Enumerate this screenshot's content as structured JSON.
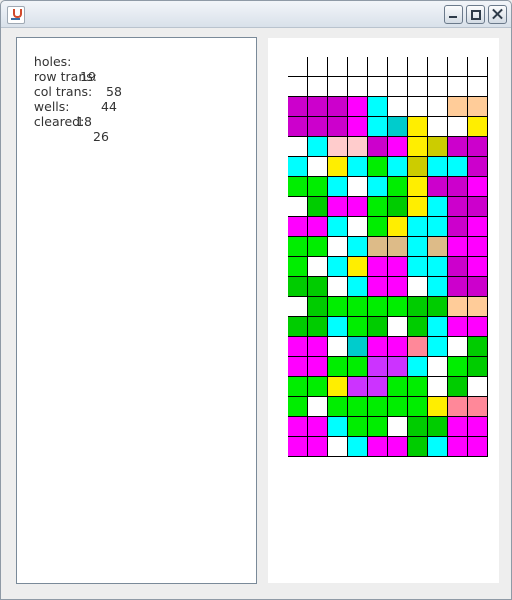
{
  "window": {
    "title": "",
    "controls": [
      "minimize-icon",
      "maximize-icon",
      "close-icon"
    ]
  },
  "stats": [
    {
      "label": "holes:",
      "value": "19"
    },
    {
      "label": "row trans:",
      "value": "58"
    },
    {
      "label": "col trans:",
      "value": "44"
    },
    {
      "label": "wells:",
      "value": "18"
    },
    {
      "label": "cleared:",
      "value": "26"
    }
  ],
  "colors": {
    "w": "#ffffff",
    "m": "#ff00ff",
    "p": "#cc00cc",
    "c": "#00ffff",
    "t": "#00cccc",
    "g": "#00ee00",
    "d": "#00cc00",
    "y": "#ffee00",
    "o": "#cccc00",
    "n": "#ffcccc",
    "s": "#ffcc99",
    "b": "#ddbb88",
    "r": "#ff8899",
    "v": "#cc33ff",
    "k": "#44dddd"
  },
  "board": {
    "columns": 10,
    "rows": [
      "wwwwwwwwww",
      "wwwwwwwwww",
      "pppmcwwwss",
      "pppmctywwy",
      "wcnnpmyoppp",
      "cwycgcoccpm",
      "ggcwcgyppm",
      "wdmmgdycpp",
      "mmcwgyccpm",
      "ggwcbbcbmm",
      "gwcymmccpm",
      "ddwcmmwcpp",
      "wdggggddss",
      "ddcgdwdcmm",
      "mmwtmmrcwd",
      "mmggvvcwgd",
      "ggyvvggwd",
      "gwgggggyrr",
      "mmcggwddmm",
      "mmwcmmdcmm"
    ]
  }
}
